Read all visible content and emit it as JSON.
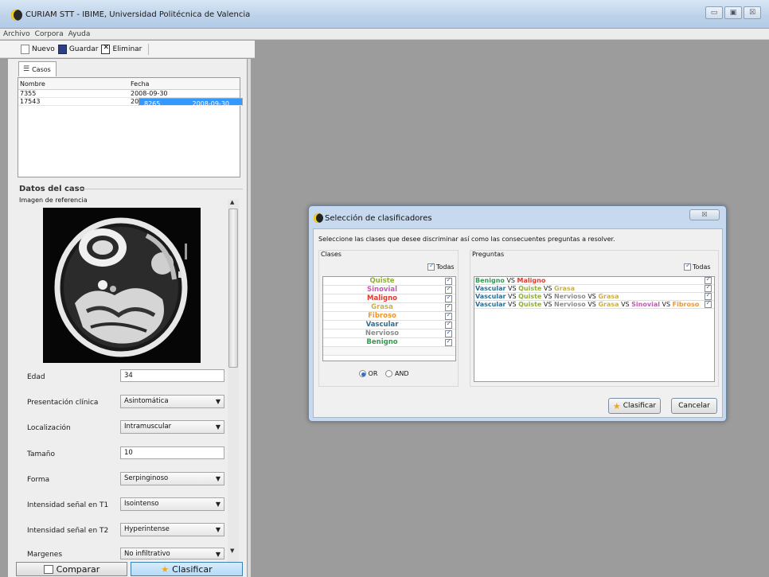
{
  "window": {
    "title": "CURIAM STT - IBIME, Universidad Politécnica de Valencia",
    "min": "▭",
    "max": "▣",
    "close": "☒"
  },
  "menu": [
    "Archivo",
    "Corpora",
    "Ayuda"
  ],
  "toolbar": {
    "new": "Nuevo",
    "save": "Guardar",
    "delete": "Eliminar"
  },
  "cases_tab": "Casos",
  "cases_table": {
    "headers": [
      "Nombre",
      "Fecha"
    ],
    "rows": [
      {
        "nombre": "7355",
        "fecha": "2008-09-30",
        "selected": false
      },
      {
        "nombre": "8265",
        "fecha": "2008-09-30",
        "selected": true
      },
      {
        "nombre": "17543",
        "fecha": "2008-09-30",
        "selected": false
      }
    ]
  },
  "case_data": {
    "section_title": "Datos del caso",
    "image_label": "Imagen de referencia",
    "fields": [
      {
        "label": "Edad",
        "type": "input",
        "value": "34"
      },
      {
        "label": "Presentación clínica",
        "type": "select",
        "value": "Asintomática"
      },
      {
        "label": "Localización",
        "type": "select",
        "value": "Intramuscular"
      },
      {
        "label": "Tamaño",
        "type": "input",
        "value": "10"
      },
      {
        "label": "Forma",
        "type": "select",
        "value": "Serpinginoso"
      },
      {
        "label": "Intensidad señal en T1",
        "type": "select",
        "value": "Isointenso"
      },
      {
        "label": "Intensidad señal en T2",
        "type": "select",
        "value": "Hyperintense"
      },
      {
        "label": "Margenes",
        "type": "select",
        "value": "No infiltrativo"
      }
    ]
  },
  "bottom_buttons": {
    "compare": "Comparar",
    "classify": "Clasificar"
  },
  "dialog": {
    "title": "Selección de clasificadores",
    "close": "☒",
    "instructions": "Seleccione las clases que desee discriminar así como las consecuentes preguntas a resolver.",
    "classes_label": "Clases",
    "questions_label": "Preguntas",
    "select_all": "Todas",
    "classes": [
      {
        "name": "Quiste",
        "color": "#8fae3c"
      },
      {
        "name": "Sinovial",
        "color": "#c756b0"
      },
      {
        "name": "Maligno",
        "color": "#e0392c"
      },
      {
        "name": "Grasa",
        "color": "#c9b04a"
      },
      {
        "name": "Fibroso",
        "color": "#f0962a"
      },
      {
        "name": "Vascular",
        "color": "#2a6f96"
      },
      {
        "name": "Nervioso",
        "color": "#8b8b8b"
      },
      {
        "name": "Benigno",
        "color": "#2f9b4d"
      }
    ],
    "logic": {
      "or": "OR",
      "and": "AND",
      "selected": "OR"
    },
    "vs_text": "VS",
    "questions": [
      {
        "classes": [
          "Benigno",
          "Maligno"
        ]
      },
      {
        "classes": [
          "Vascular",
          "Quiste",
          "Grasa"
        ]
      },
      {
        "classes": [
          "Vascular",
          "Quiste",
          "Nervioso",
          "Grasa"
        ]
      },
      {
        "classes": [
          "Vascular",
          "Quiste",
          "Nervioso",
          "Grasa",
          "Sinovial",
          "Fibroso"
        ]
      }
    ],
    "classify_button": "Clasificar",
    "cancel_button": "Cancelar"
  }
}
